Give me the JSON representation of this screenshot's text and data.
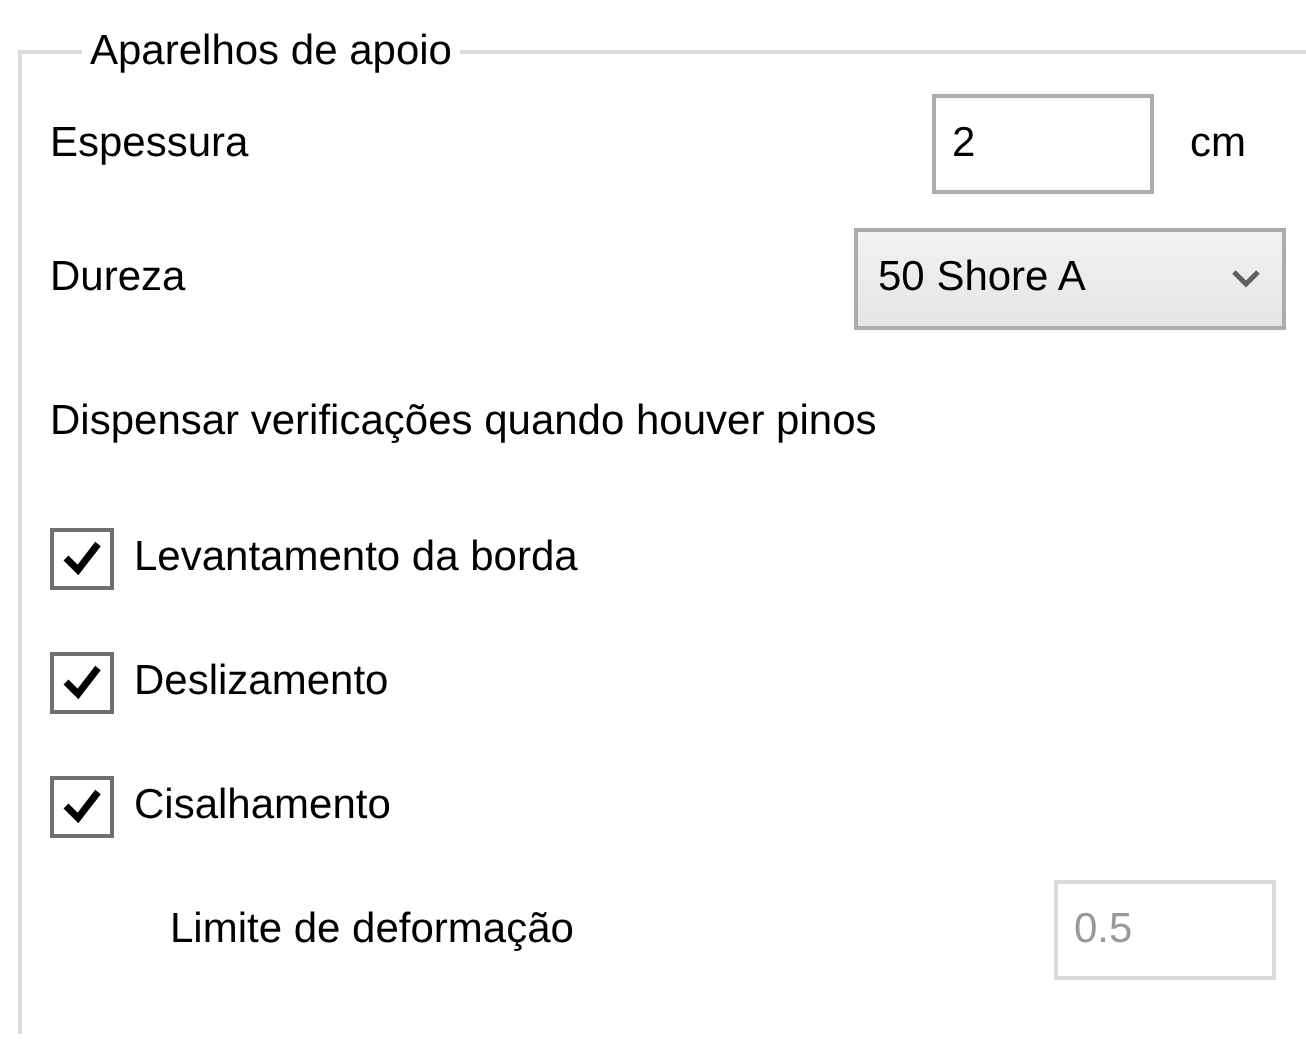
{
  "group": {
    "title": "Aparelhos de apoio"
  },
  "thickness": {
    "label": "Espessura",
    "value": "2",
    "unit": "cm"
  },
  "hardness": {
    "label": "Dureza",
    "value": "50 Shore A"
  },
  "note": "Dispensar verificações quando houver pinos",
  "checks": [
    {
      "label": "Levantamento da borda",
      "checked": true
    },
    {
      "label": "Deslizamento",
      "checked": true
    },
    {
      "label": "Cisalhamento",
      "checked": true
    }
  ],
  "limit": {
    "label": "Limite de deformação",
    "value": "0.5",
    "disabled": true
  }
}
